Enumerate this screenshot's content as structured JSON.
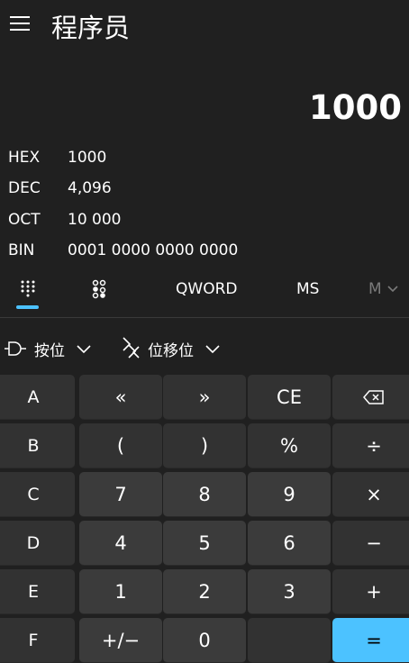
{
  "app": {
    "title": "程序员"
  },
  "display": {
    "value": "1000"
  },
  "radix": [
    {
      "label": "HEX",
      "value": "1000"
    },
    {
      "label": "DEC",
      "value": "4,096"
    },
    {
      "label": "OCT",
      "value": "10 000"
    },
    {
      "label": "BIN",
      "value": "0001 0000 0000 0000"
    }
  ],
  "tabs": {
    "word_size": "QWORD",
    "memory_store": "MS",
    "memory_recall": "M"
  },
  "menus": {
    "bitwise": "按位",
    "bitshift": "位移位"
  },
  "keys": {
    "row1": [
      "A",
      "«",
      "»",
      "CE",
      "⌫"
    ],
    "row2": [
      "B",
      "(",
      ")",
      "%",
      "÷"
    ],
    "row3": [
      "C",
      "7",
      "8",
      "9",
      "×"
    ],
    "row4": [
      "D",
      "4",
      "5",
      "6",
      "−"
    ],
    "row5": [
      "E",
      "1",
      "2",
      "3",
      "+"
    ],
    "row6": [
      "F",
      "+/−",
      "0",
      "",
      "="
    ]
  },
  "colors": {
    "background": "#202020",
    "key": "#3b3b3b",
    "key_alt": "#323232",
    "accent": "#4cc2ff"
  }
}
